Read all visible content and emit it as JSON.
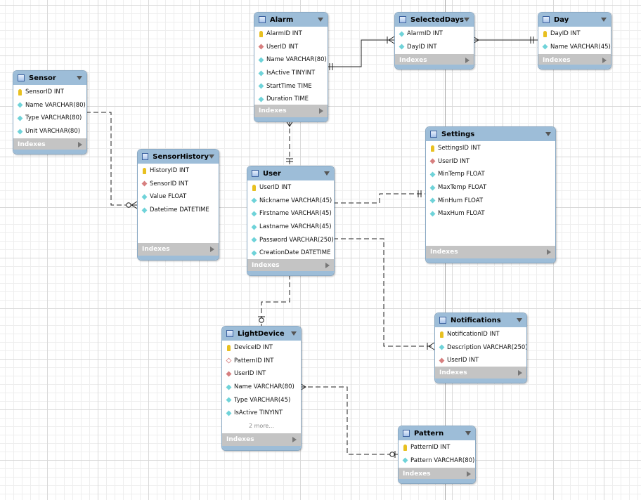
{
  "diagram": {
    "indexes_label": "Indexes",
    "tables": [
      {
        "id": "alarm",
        "name": "Alarm",
        "columns": [
          {
            "icon": "pk",
            "text": "AlarmID INT"
          },
          {
            "icon": "fk",
            "text": "UserID INT"
          },
          {
            "icon": "col",
            "text": "Name VARCHAR(80)"
          },
          {
            "icon": "col",
            "text": "IsActive TINYINT"
          },
          {
            "icon": "col",
            "text": "StartTime TIME"
          },
          {
            "icon": "col",
            "text": "Duration TIME"
          }
        ]
      },
      {
        "id": "selecteddays",
        "name": "SelectedDays",
        "columns": [
          {
            "icon": "col",
            "text": "AlarmID INT"
          },
          {
            "icon": "col",
            "text": "DayID INT"
          }
        ]
      },
      {
        "id": "day",
        "name": "Day",
        "columns": [
          {
            "icon": "pk",
            "text": "DayID INT"
          },
          {
            "icon": "col",
            "text": "Name VARCHAR(45)"
          }
        ]
      },
      {
        "id": "sensor",
        "name": "Sensor",
        "columns": [
          {
            "icon": "pk",
            "text": "SensorID INT"
          },
          {
            "icon": "col",
            "text": "Name VARCHAR(80)"
          },
          {
            "icon": "col",
            "text": "Type VARCHAR(80)"
          },
          {
            "icon": "col",
            "text": "Unit VARCHAR(80)"
          }
        ]
      },
      {
        "id": "sensorhistory",
        "name": "SensorHistory",
        "columns": [
          {
            "icon": "pk",
            "text": "HistoryID INT"
          },
          {
            "icon": "fk",
            "text": "SensorID INT"
          },
          {
            "icon": "col",
            "text": "Value FLOAT"
          },
          {
            "icon": "col",
            "text": "Datetime DATETIME"
          }
        ]
      },
      {
        "id": "user",
        "name": "User",
        "columns": [
          {
            "icon": "pk",
            "text": "UserID INT"
          },
          {
            "icon": "col",
            "text": "Nickname VARCHAR(45)"
          },
          {
            "icon": "col",
            "text": "Firstname VARCHAR(45)"
          },
          {
            "icon": "col",
            "text": "Lastname VARCHAR(45)"
          },
          {
            "icon": "col",
            "text": "Password VARCHAR(250)"
          },
          {
            "icon": "col",
            "text": "CreationDate DATETIME"
          }
        ]
      },
      {
        "id": "settings",
        "name": "Settings",
        "columns": [
          {
            "icon": "pk",
            "text": "SettingsID INT"
          },
          {
            "icon": "fk",
            "text": "UserID INT"
          },
          {
            "icon": "col",
            "text": "MinTemp FLOAT"
          },
          {
            "icon": "col",
            "text": "MaxTemp FLOAT"
          },
          {
            "icon": "col",
            "text": "MinHum FLOAT"
          },
          {
            "icon": "col",
            "text": "MaxHum FLOAT"
          }
        ]
      },
      {
        "id": "notifications",
        "name": "Notifications",
        "columns": [
          {
            "icon": "pk",
            "text": "NotificationID INT"
          },
          {
            "icon": "col",
            "text": "Description VARCHAR(250)"
          },
          {
            "icon": "fk",
            "text": "UserID INT"
          }
        ]
      },
      {
        "id": "lightdevice",
        "name": "LightDevice",
        "more": "2 more...",
        "columns": [
          {
            "icon": "pk",
            "text": "DeviceID INT"
          },
          {
            "icon": "fkn",
            "text": "PatternID INT"
          },
          {
            "icon": "fk",
            "text": "UserID INT"
          },
          {
            "icon": "col",
            "text": "Name VARCHAR(80)"
          },
          {
            "icon": "col",
            "text": "Type VARCHAR(45)"
          },
          {
            "icon": "col",
            "text": "IsActive TINYINT"
          }
        ]
      },
      {
        "id": "pattern",
        "name": "Pattern",
        "columns": [
          {
            "icon": "pk",
            "text": "PatternID INT"
          },
          {
            "icon": "col",
            "text": "Pattern VARCHAR(80)"
          }
        ]
      }
    ],
    "relationships": [
      {
        "from": "alarm",
        "to": "selecteddays",
        "style": "identifying",
        "from_card": "one",
        "to_card": "one-or-many"
      },
      {
        "from": "day",
        "to": "selecteddays",
        "style": "identifying",
        "from_card": "one",
        "to_card": "zero-or-many"
      },
      {
        "from": "user",
        "to": "alarm",
        "style": "non-identifying",
        "from_card": "one",
        "to_card": "zero-or-many"
      },
      {
        "from": "sensor",
        "to": "sensorhistory",
        "style": "non-identifying",
        "from_card": "one",
        "to_card": "zero-or-many"
      },
      {
        "from": "user",
        "to": "settings",
        "style": "non-identifying",
        "from_card": "one",
        "to_card": "one"
      },
      {
        "from": "user",
        "to": "notifications",
        "style": "non-identifying",
        "from_card": "one",
        "to_card": "one-or-many"
      },
      {
        "from": "user",
        "to": "lightdevice",
        "style": "non-identifying",
        "from_card": "one",
        "to_card": "zero-or-one"
      },
      {
        "from": "pattern",
        "to": "lightdevice",
        "style": "non-identifying",
        "from_card": "zero-or-one",
        "to_card": "zero-or-many"
      }
    ]
  }
}
